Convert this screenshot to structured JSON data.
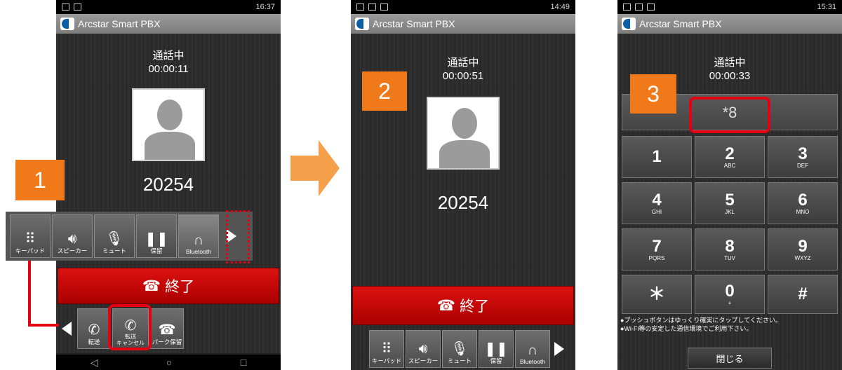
{
  "app_title": "Arcstar Smart PBX",
  "colors": {
    "accent_orange": "#f07a1a",
    "highlight_red": "#e60012",
    "end_call_red": "#c00"
  },
  "screen1": {
    "time": "16:37",
    "status_text": "通話中",
    "duration": "00:00:11",
    "number": "20254",
    "badge": "1",
    "buttons": [
      {
        "icon": "keypad-icon",
        "label": "キーパッド"
      },
      {
        "icon": "speaker-icon",
        "label": "スピーカー"
      },
      {
        "icon": "mute-icon",
        "label": "ミュート"
      },
      {
        "icon": "hold-icon",
        "label": "保留"
      },
      {
        "icon": "headphones-icon",
        "label": "Bluetooth"
      }
    ],
    "end_label": "終了",
    "sub_buttons": [
      {
        "icon": "transfer-icon",
        "label": "転送"
      },
      {
        "icon": "cancel-transfer-icon",
        "label": "転送\nキャンセル"
      },
      {
        "icon": "park-hold-icon",
        "label": "パーク保留"
      }
    ],
    "nav": [
      "◁",
      "○",
      "□"
    ]
  },
  "screen2": {
    "time": "14:49",
    "status_text": "通話中",
    "duration": "00:00:51",
    "number": "20254",
    "badge": "2",
    "end_label": "終了",
    "buttons": [
      {
        "icon": "keypad-icon",
        "label": "キーパッド"
      },
      {
        "icon": "speaker-icon",
        "label": "スピーカー"
      },
      {
        "icon": "mute-icon",
        "label": "ミュート"
      },
      {
        "icon": "hold-icon",
        "label": "保留"
      },
      {
        "icon": "headphones-icon",
        "label": "Bluetooth"
      }
    ]
  },
  "screen3": {
    "time": "15:31",
    "status_text": "通話中",
    "duration": "00:00:33",
    "badge": "3",
    "dial_input": "*8",
    "keys": [
      {
        "d": "1",
        "l": ""
      },
      {
        "d": "2",
        "l": "ABC"
      },
      {
        "d": "3",
        "l": "DEF"
      },
      {
        "d": "4",
        "l": "GHI"
      },
      {
        "d": "5",
        "l": "JKL"
      },
      {
        "d": "6",
        "l": "MNO"
      },
      {
        "d": "7",
        "l": "PQRS"
      },
      {
        "d": "8",
        "l": "TUV"
      },
      {
        "d": "9",
        "l": "WXYZ"
      },
      {
        "d": "＊",
        "l": ""
      },
      {
        "d": "0",
        "l": "+"
      },
      {
        "d": "#",
        "l": ""
      }
    ],
    "note1": "●プッシュボタンはゆっくり確実にタップしてください。",
    "note2": "●Wi-Fi等の安定した通信環境でご利用下さい。",
    "close_label": "閉じる"
  }
}
